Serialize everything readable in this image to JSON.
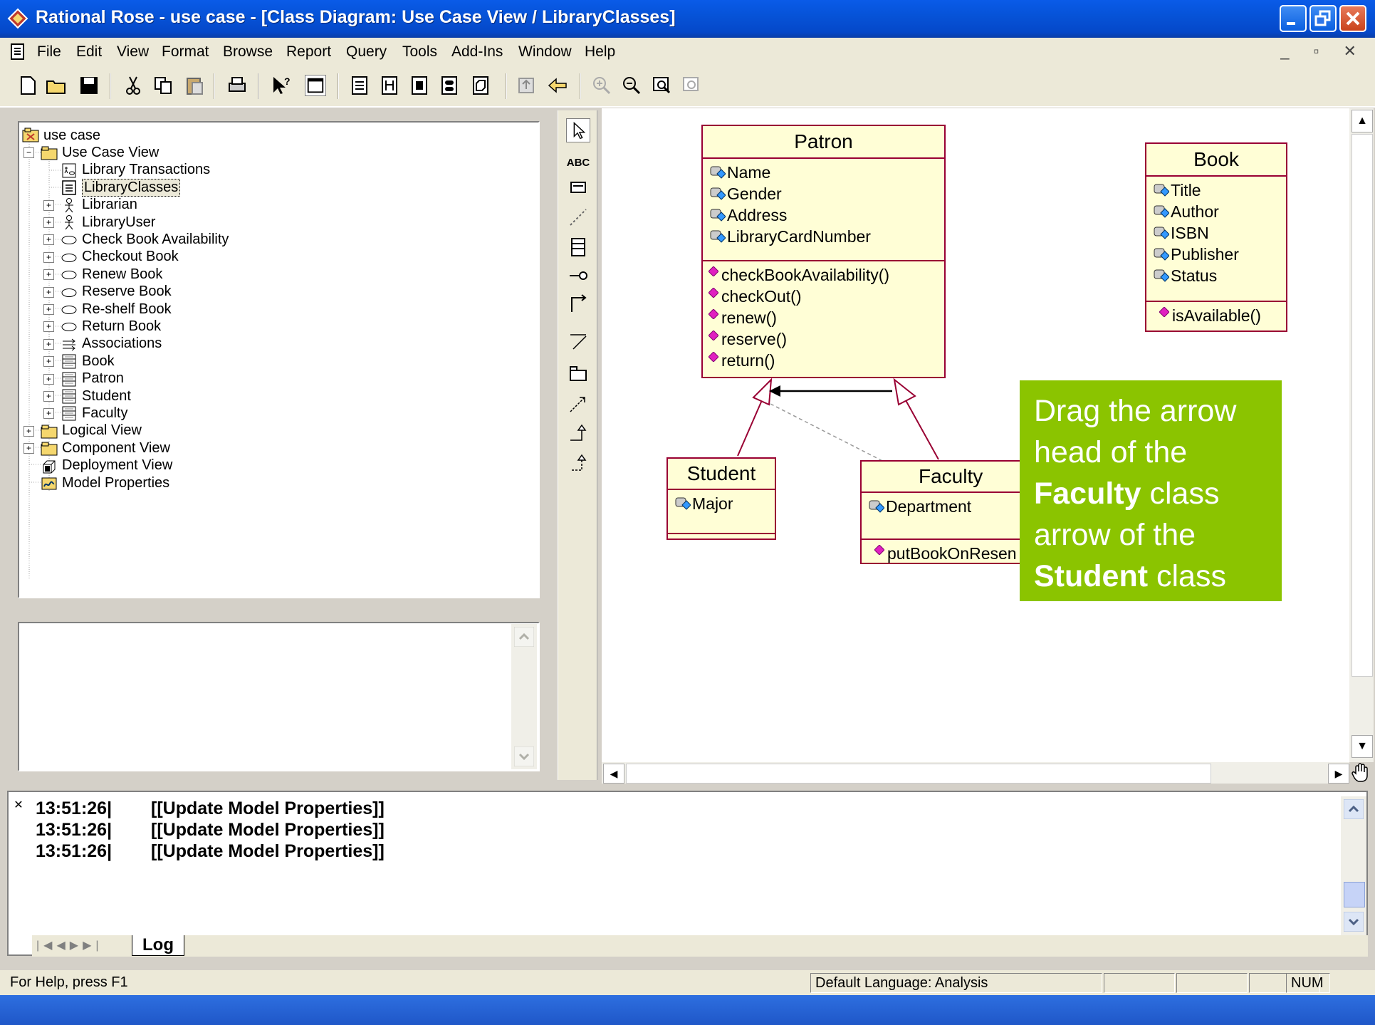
{
  "window": {
    "title": "Rational Rose - use case - [Class Diagram: Use Case View / LibraryClasses]"
  },
  "menu": [
    "File",
    "Edit",
    "View",
    "Format",
    "Browse",
    "Report",
    "Query",
    "Tools",
    "Add-Ins",
    "Window",
    "Help"
  ],
  "tree": {
    "root": "use case",
    "items": [
      {
        "label": "Use Case View",
        "icon": "folder-icon"
      },
      {
        "label": "Library Transactions",
        "icon": "usecase-diagram-icon"
      },
      {
        "label": "LibraryClasses",
        "icon": "class-diagram-icon",
        "selected": true
      },
      {
        "label": "Librarian",
        "icon": "actor-icon"
      },
      {
        "label": "LibraryUser",
        "icon": "actor-icon"
      },
      {
        "label": "Check Book Availability",
        "icon": "usecase-icon"
      },
      {
        "label": "Checkout Book",
        "icon": "usecase-icon"
      },
      {
        "label": "Renew Book",
        "icon": "usecase-icon"
      },
      {
        "label": "Reserve Book",
        "icon": "usecase-icon"
      },
      {
        "label": "Re-shelf Book",
        "icon": "usecase-icon"
      },
      {
        "label": "Return Book",
        "icon": "usecase-icon"
      },
      {
        "label": "Associations",
        "icon": "associations-icon"
      },
      {
        "label": "Book",
        "icon": "class-icon"
      },
      {
        "label": "Patron",
        "icon": "class-icon"
      },
      {
        "label": "Student",
        "icon": "class-icon"
      },
      {
        "label": "Faculty",
        "icon": "class-icon"
      },
      {
        "label": "Logical View",
        "icon": "folder-icon"
      },
      {
        "label": "Component View",
        "icon": "folder-icon"
      },
      {
        "label": "Deployment View",
        "icon": "deployment-icon"
      },
      {
        "label": "Model Properties",
        "icon": "model-properties-icon"
      }
    ]
  },
  "classes": {
    "patron": {
      "name": "Patron",
      "attributes": [
        "Name",
        "Gender",
        "Address",
        "LibraryCardNumber"
      ],
      "operations": [
        "checkBookAvailability()",
        "checkOut()",
        "renew()",
        "reserve()",
        "return()"
      ]
    },
    "book": {
      "name": "Book",
      "attributes": [
        "Title",
        "Author",
        "ISBN",
        "Publisher",
        "Status"
      ],
      "operations": [
        "isAvailable()"
      ]
    },
    "student": {
      "name": "Student",
      "attributes": [
        "Major"
      ],
      "operations": []
    },
    "faculty": {
      "name": "Faculty",
      "attributes": [
        "Department"
      ],
      "operations": [
        "putBookOnResen"
      ]
    }
  },
  "callout": {
    "line1": "Drag the arrow head of the",
    "bold1": "Faculty",
    "line2": " class arrow of the",
    "bold2": "Student",
    "line3": " class"
  },
  "log": [
    {
      "time": "13:51:26|",
      "message": "[[Update Model Properties]]"
    },
    {
      "time": "13:51:26|",
      "message": "[[Update Model Properties]]"
    },
    {
      "time": "13:51:26|",
      "message": "[[Update Model Properties]]"
    }
  ],
  "log_tab": "Log",
  "status": {
    "help": "For Help, press F1",
    "language": "Default Language: Analysis",
    "num": "NUM"
  },
  "colors": {
    "class_border": "#990033",
    "class_fill": "#fffed6",
    "callout": "#8bc400",
    "titlebar": "#0653d8"
  }
}
